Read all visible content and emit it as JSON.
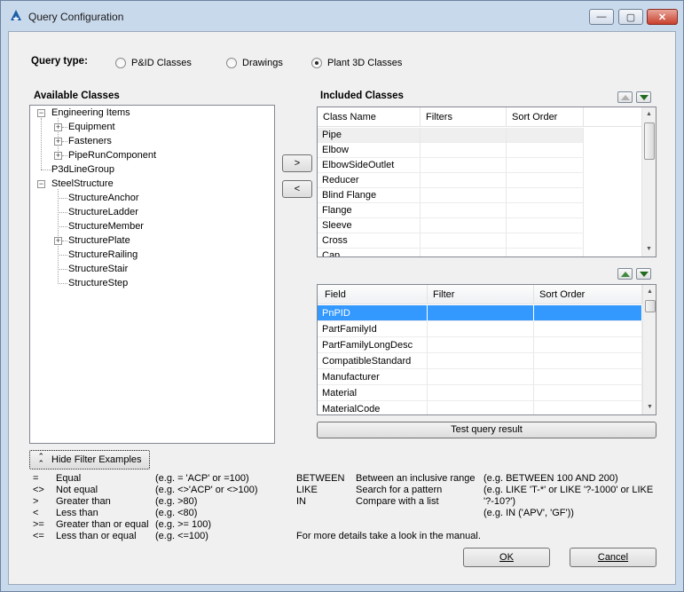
{
  "window": {
    "title": "Query Configuration",
    "min_glyph": "—",
    "max_glyph": "▢",
    "close_glyph": "✕"
  },
  "query_type": {
    "label": "Query type:",
    "options": [
      {
        "label": "P&ID Classes",
        "selected": false
      },
      {
        "label": "Drawings",
        "selected": false
      },
      {
        "label": "Plant 3D Classes",
        "selected": true
      }
    ]
  },
  "available": {
    "title": "Available Classes",
    "tree": [
      {
        "label": "Engineering Items",
        "expander": "−"
      },
      {
        "label": "Equipment",
        "expander": "+"
      },
      {
        "label": "Fasteners",
        "expander": "+"
      },
      {
        "label": "PipeRunComponent",
        "expander": "+"
      },
      {
        "label": "P3dLineGroup"
      },
      {
        "label": "SteelStructure",
        "expander": "−"
      },
      {
        "label": "StructureAnchor"
      },
      {
        "label": "StructureLadder"
      },
      {
        "label": "StructureMember"
      },
      {
        "label": "StructurePlate",
        "expander": "+"
      },
      {
        "label": "StructureRailing"
      },
      {
        "label": "StructureStair"
      },
      {
        "label": "StructureStep"
      }
    ]
  },
  "move_buttons": {
    "add": ">",
    "remove": "<"
  },
  "included": {
    "title": "Included Classes",
    "columns": [
      "Class Name",
      "Filters",
      "Sort Order"
    ],
    "rows": [
      "Pipe",
      "Elbow",
      "ElbowSideOutlet",
      "Reducer",
      "Blind Flange",
      "Flange",
      "Sleeve",
      "Cross",
      "Cap"
    ]
  },
  "fields": {
    "columns": [
      "Field",
      "Filter",
      "Sort Order"
    ],
    "rows": [
      "PnPID",
      "PartFamilyId",
      "PartFamilyLongDesc",
      "CompatibleStandard",
      "Manufacturer",
      "Material",
      "MaterialCode"
    ],
    "selected_color": "#3399ff"
  },
  "test_button": "Test query result",
  "hide_button": "Hide Filter Examples",
  "examples_left": [
    {
      "op": "=",
      "desc": "Equal",
      "eg": "(e.g. = 'ACP' or =100)"
    },
    {
      "op": "<>",
      "desc": "Not equal",
      "eg": "(e.g. <>'ACP' or <>100)"
    },
    {
      "op": ">",
      "desc": "Greater than",
      "eg": "(e.g. >80)"
    },
    {
      "op": "<",
      "desc": "Less than",
      "eg": "(e.g. <80)"
    },
    {
      "op": ">=",
      "desc": "Greater than or equal",
      "eg": "(e.g. >= 100)"
    },
    {
      "op": "<=",
      "desc": "Less than or equal",
      "eg": "(e.g. <=100)"
    }
  ],
  "examples_right": [
    {
      "op": "BETWEEN",
      "desc": "Between an inclusive range",
      "eg": "(e.g. BETWEEN 100 AND 200)"
    },
    {
      "op": "LIKE",
      "desc": "Search for a pattern",
      "eg": "(e.g. LIKE 'T-*' or LIKE '?-1000' or LIKE",
      "eg2": "'?-10?')"
    },
    {
      "op": "IN",
      "desc": "Compare with a list",
      "eg": "(e.g. IN ('APV', 'GF'))"
    }
  ],
  "manual_note": "For more details take a look in the manual.",
  "ok_label": "OK",
  "cancel_label": "Cancel"
}
